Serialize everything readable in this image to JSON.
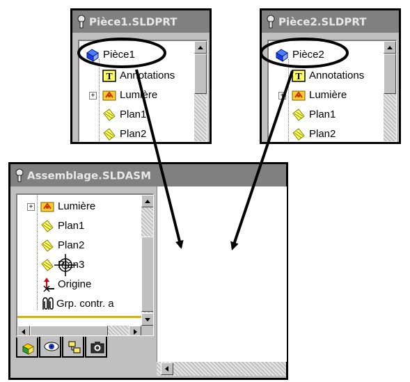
{
  "colors": {
    "annotation_ellipse": "#000000",
    "arrow": "#000000",
    "titlebar_bg": "#808080",
    "window_bg": "#c0c0c0"
  },
  "part1": {
    "title": "Pièce1.SLDPRT",
    "items": [
      {
        "label": "Pièce1",
        "icon": "part-icon"
      },
      {
        "label": "Annotations",
        "icon": "annotations-icon"
      },
      {
        "label": "Lumière",
        "icon": "light-icon"
      },
      {
        "label": "Plan1",
        "icon": "plane-icon"
      },
      {
        "label": "Plan2",
        "icon": "plane-icon"
      }
    ]
  },
  "part2": {
    "title": "Pièce2.SLDPRT",
    "items": [
      {
        "label": "Pièce2",
        "icon": "part-icon"
      },
      {
        "label": "Annotations",
        "icon": "annotations-icon"
      },
      {
        "label": "Lumière",
        "icon": "light-icon"
      },
      {
        "label": "Plan1",
        "icon": "plane-icon"
      },
      {
        "label": "Plan2",
        "icon": "plane-icon"
      }
    ]
  },
  "assembly": {
    "title": "Assemblage.SLDASM",
    "items": [
      {
        "label": "Lumière",
        "icon": "light-icon"
      },
      {
        "label": "Plan1",
        "icon": "plane-icon"
      },
      {
        "label": "Plan2",
        "icon": "plane-icon"
      },
      {
        "label": "Plan3",
        "icon": "plane-icon"
      },
      {
        "label": "Origine",
        "icon": "origin-icon"
      },
      {
        "label": "Grp. contr. a",
        "icon": "mates-icon"
      }
    ],
    "tabs": [
      {
        "icon": "feature-manager-icon"
      },
      {
        "icon": "display-manager-icon"
      },
      {
        "icon": "configuration-manager-icon"
      },
      {
        "icon": "photo-manager-icon"
      }
    ]
  }
}
